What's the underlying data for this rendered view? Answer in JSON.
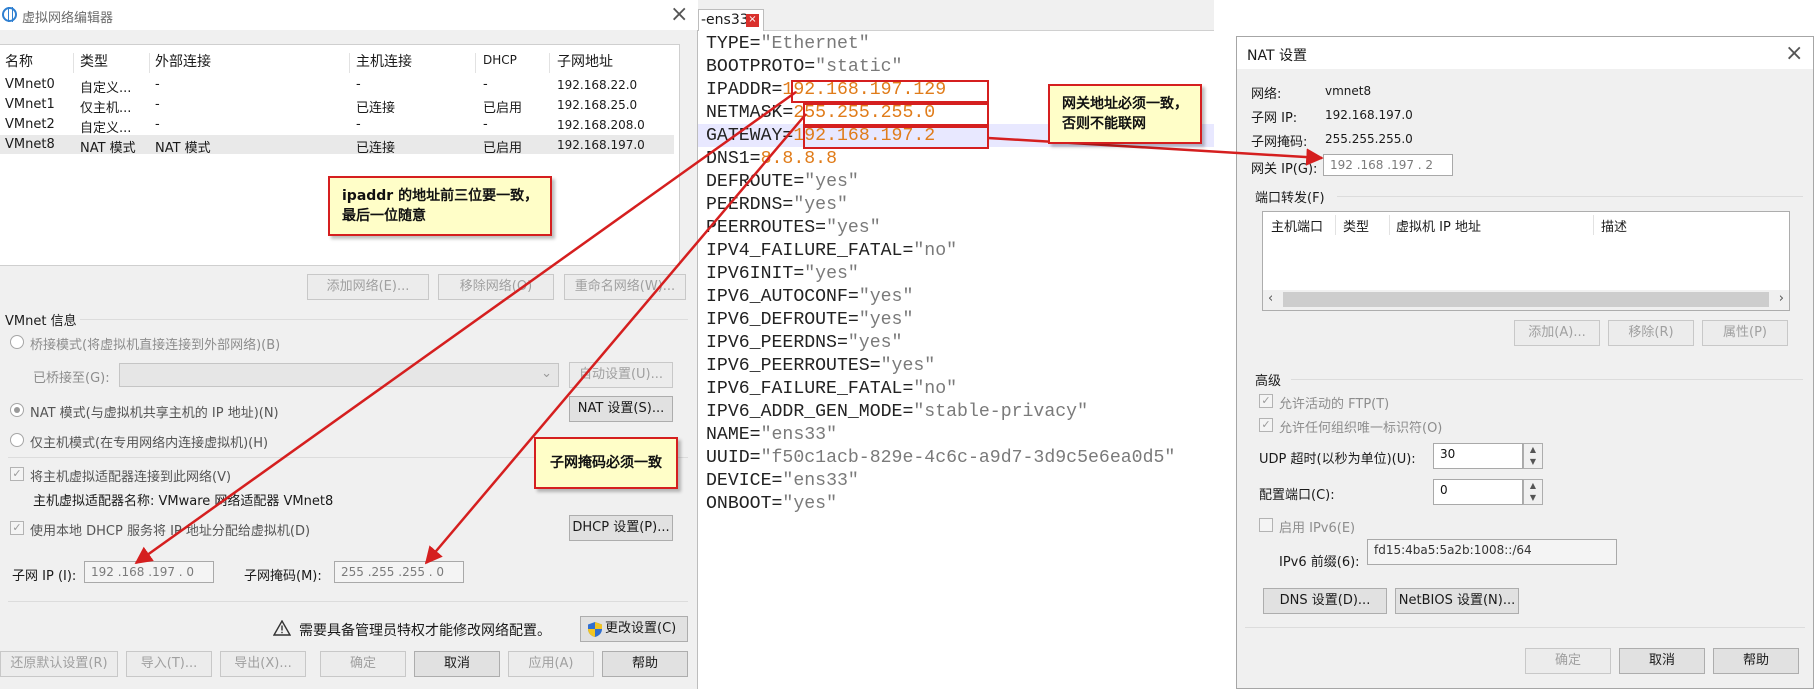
{
  "left_window": {
    "title": "虚拟网络编辑器",
    "columns": [
      "名称",
      "类型",
      "外部连接",
      "主机连接",
      "DHCP",
      "子网地址"
    ],
    "rows": [
      {
        "name": "VMnet0",
        "type": "自定义...",
        "external": "-",
        "host": "-",
        "dhcp": "-",
        "subnet": "192.168.22.0"
      },
      {
        "name": "VMnet1",
        "type": "仅主机...",
        "external": "-",
        "host": "已连接",
        "dhcp": "已启用",
        "subnet": "192.168.25.0"
      },
      {
        "name": "VMnet2",
        "type": "自定义...",
        "external": "-",
        "host": "-",
        "dhcp": "-",
        "subnet": "192.168.208.0"
      },
      {
        "name": "VMnet8",
        "type": "NAT 模式",
        "external": "NAT 模式",
        "host": "已连接",
        "dhcp": "已启用",
        "subnet": "192.168.197.0"
      }
    ],
    "add_network": "添加网络(E)...",
    "remove_network": "移除网络(O)",
    "rename_network": "重命名网络(W)...",
    "vmnet_info": "VMnet 信息",
    "bridge_mode": "桥接模式(将虚拟机直接连接到外部网络)(B)",
    "bridged_to": "已桥接至(G):",
    "auto_settings": "自动设置(U)...",
    "nat_mode": "NAT 模式(与虚拟机共享主机的 IP 地址)(N)",
    "nat_settings": "NAT 设置(S)...",
    "host_only_mode": "仅主机模式(在专用网络内连接虚拟机)(H)",
    "connect_adapter": "将主机虚拟适配器连接到此网络(V)",
    "adapter_name": "主机虚拟适配器名称: VMware 网络适配器 VMnet8",
    "use_dhcp": "使用本地 DHCP 服务将 IP 地址分配给虚拟机(D)",
    "dhcp_settings": "DHCP 设置(P)...",
    "subnet_ip_label": "子网 IP (I):",
    "subnet_ip_value": "192 .168 .197 . 0",
    "subnet_mask_label": "子网掩码(M):",
    "subnet_mask_value": "255 .255 .255 . 0",
    "admin_warning": "需要具备管理员特权才能修改网络配置。",
    "change_settings": "更改设置(C)",
    "restore_defaults": "还原默认设置(R)",
    "import": "导入(T)...",
    "export": "导出(X)...",
    "ok": "确定",
    "cancel": "取消",
    "apply": "应用(A)",
    "help": "帮助"
  },
  "editor": {
    "tab": "-ens33",
    "lines": [
      {
        "key": "TYPE=",
        "val": "\"Ethernet\"",
        "style": "s"
      },
      {
        "key": "BOOTPROTO=",
        "val": "\"static\"",
        "style": "s"
      },
      {
        "key": "IPADDR=",
        "val": "192.168.197.129",
        "style": "v"
      },
      {
        "key": "NETMASK=",
        "val": "255.255.255.0",
        "style": "v"
      },
      {
        "key": "GATEWAY=",
        "val": "192.168.197.2",
        "style": "v"
      },
      {
        "key": "DNS1=",
        "val": "8.8.8.8",
        "style": "v"
      },
      {
        "key": "DEFROUTE=",
        "val": "\"yes\"",
        "style": "s"
      },
      {
        "key": "PEERDNS=",
        "val": "\"yes\"",
        "style": "s"
      },
      {
        "key": "PEERROUTES=",
        "val": "\"yes\"",
        "style": "s"
      },
      {
        "key": "IPV4_FAILURE_FATAL=",
        "val": "\"no\"",
        "style": "s"
      },
      {
        "key": "IPV6INIT=",
        "val": "\"yes\"",
        "style": "s"
      },
      {
        "key": "IPV6_AUTOCONF=",
        "val": "\"yes\"",
        "style": "s"
      },
      {
        "key": "IPV6_DEFROUTE=",
        "val": "\"yes\"",
        "style": "s"
      },
      {
        "key": "IPV6_PEERDNS=",
        "val": "\"yes\"",
        "style": "s"
      },
      {
        "key": "IPV6_PEERROUTES=",
        "val": "\"yes\"",
        "style": "s"
      },
      {
        "key": "IPV6_FAILURE_FATAL=",
        "val": "\"no\"",
        "style": "s"
      },
      {
        "key": "IPV6_ADDR_GEN_MODE=",
        "val": "\"stable-privacy\"",
        "style": "s"
      },
      {
        "key": "NAME=",
        "val": "\"ens33\"",
        "style": "s"
      },
      {
        "key": "UUID=",
        "val": "\"f50c1acb-829e-4c6c-a9d7-3d9c5e6ea0d5\"",
        "style": "s"
      },
      {
        "key": "DEVICE=",
        "val": "\"ens33\"",
        "style": "s"
      },
      {
        "key": "ONBOOT=",
        "val": "\"yes\"",
        "style": "s"
      }
    ]
  },
  "nat_dialog": {
    "title": "NAT 设置",
    "network_label": "网络:",
    "network_value": "vmnet8",
    "subnet_ip_label": "子网 IP:",
    "subnet_ip_value": "192.168.197.0",
    "subnet_mask_label": "子网掩码:",
    "subnet_mask_value": "255.255.255.0",
    "gateway_label": "网关 IP(G):",
    "gateway_value": "192 .168 .197 . 2",
    "port_forward_label": "端口转发(F)",
    "pf_columns": [
      "主机端口",
      "类型",
      "虚拟机 IP 地址",
      "描述"
    ],
    "add": "添加(A)...",
    "remove": "移除(R)",
    "properties": "属性(P)",
    "advanced": "高级",
    "allow_ftp": "允许活动的 FTP(T)",
    "allow_uid": "允许任何组织唯一标识符(O)",
    "udp_timeout_label": "UDP 超时(以秒为单位)(U):",
    "udp_timeout_value": "30",
    "config_port_label": "配置端口(C):",
    "config_port_value": "0",
    "enable_ipv6": "启用 IPv6(E)",
    "ipv6_prefix_label": "IPv6 前缀(6):",
    "ipv6_prefix_value": "fd15:4ba5:5a2b:1008::/64",
    "dns_settings": "DNS 设置(D)...",
    "netbios_settings": "NetBIOS 设置(N)...",
    "ok": "确定",
    "cancel": "取消",
    "help": "帮助"
  },
  "annotations": {
    "ipaddr_note": [
      "ipaddr 的地址前三位要一致，",
      "最后一位随意"
    ],
    "gateway_note": [
      "网关地址必须一致，",
      "否则不能联网"
    ],
    "netmask_note": "子网掩码必须一致"
  },
  "colors": {
    "annotation_red": "#d51f1f",
    "note_bg": "#fffec8",
    "value_orange": "#e07c1a"
  }
}
